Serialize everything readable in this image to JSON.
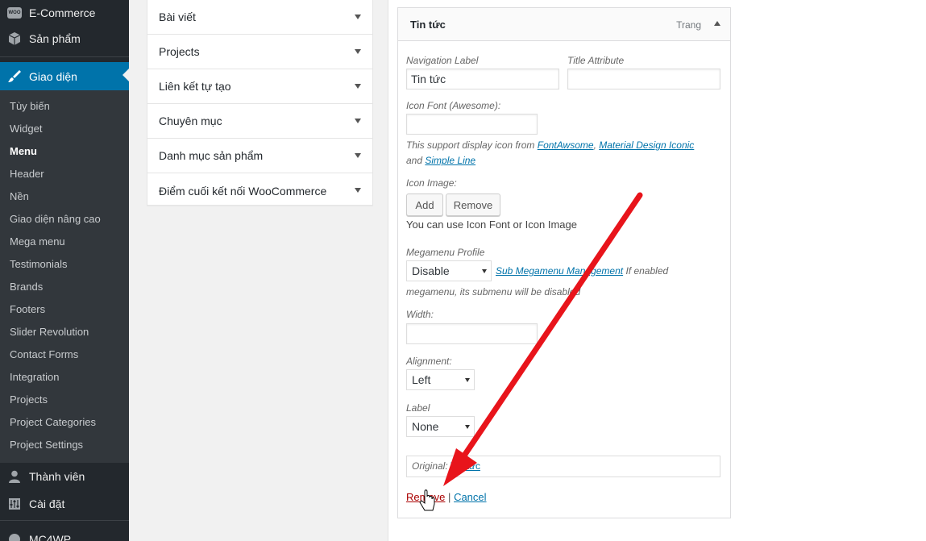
{
  "sidebar": {
    "top_items": [
      {
        "label": "E-Commerce",
        "icon": "woo-icon",
        "badge": "WOO"
      },
      {
        "label": "Sản phẩm",
        "icon": "cube-icon"
      },
      {
        "label": "Giao diện",
        "icon": "paintbrush-icon"
      }
    ],
    "submenu": [
      "Tùy biến",
      "Widget",
      "Menu",
      "Header",
      "Nền",
      "Giao diện nâng cao",
      "Mega menu",
      "Testimonials",
      "Brands",
      "Footers",
      "Slider Revolution",
      "Contact Forms",
      "Integration",
      "Projects",
      "Project Categories",
      "Project Settings"
    ],
    "bottom_items": [
      {
        "label": "Thành viên",
        "icon": "user-icon"
      },
      {
        "label": "Cài đặt",
        "icon": "settings-icon"
      },
      {
        "label": "MC4WP",
        "icon": "mc4wp-icon"
      }
    ]
  },
  "accordion": {
    "sections": [
      "Bài viết",
      "Projects",
      "Liên kết tự tạo",
      "Chuyên mục",
      "Danh mục sản phẩm",
      "Điểm cuối kết nối WooCommerce"
    ]
  },
  "menu_item": {
    "title": "Tin tức",
    "type": "Trang",
    "nav_label_label": "Navigation Label",
    "nav_label_value": "Tin tức",
    "title_attr_label": "Title Attribute",
    "title_attr_value": "",
    "icon_font_label": "Icon Font (Awesome):",
    "icon_font_value": "",
    "icon_desc_pre": "This support display icon from",
    "icon_link_fontawesome": "FontAwsome",
    "icon_desc_comma": ",",
    "icon_link_material": "Material Design Iconic",
    "icon_desc_and": "and",
    "icon_link_simpleline": "Simple Line",
    "icon_image_label": "Icon Image:",
    "add_button": "Add",
    "remove_button": "Remove",
    "icon_note": "You can use Icon Font or Icon Image",
    "megamenu_label": "Megamenu Profile",
    "megamenu_value": "Disable",
    "megamenu_link": "Sub Megamenu Management",
    "megamenu_desc_1": "If enabled",
    "megamenu_desc_2": "megamenu, its submenu will be disabled",
    "width_label": "Width:",
    "width_value": "",
    "alignment_label": "Alignment:",
    "alignment_value": "Left",
    "label_label": "Label",
    "label_value": "None",
    "original_label": "Original:",
    "original_link": "Tin tức",
    "remove_link": "Remove",
    "actions_sep": "|",
    "cancel_link": "Cancel"
  },
  "colors": {
    "sidebar_bg": "#23282d",
    "submenu_bg": "#32373c",
    "active": "#0073aa",
    "link": "#0073aa",
    "delete": "#a00",
    "annotation_arrow": "#e8141b"
  }
}
